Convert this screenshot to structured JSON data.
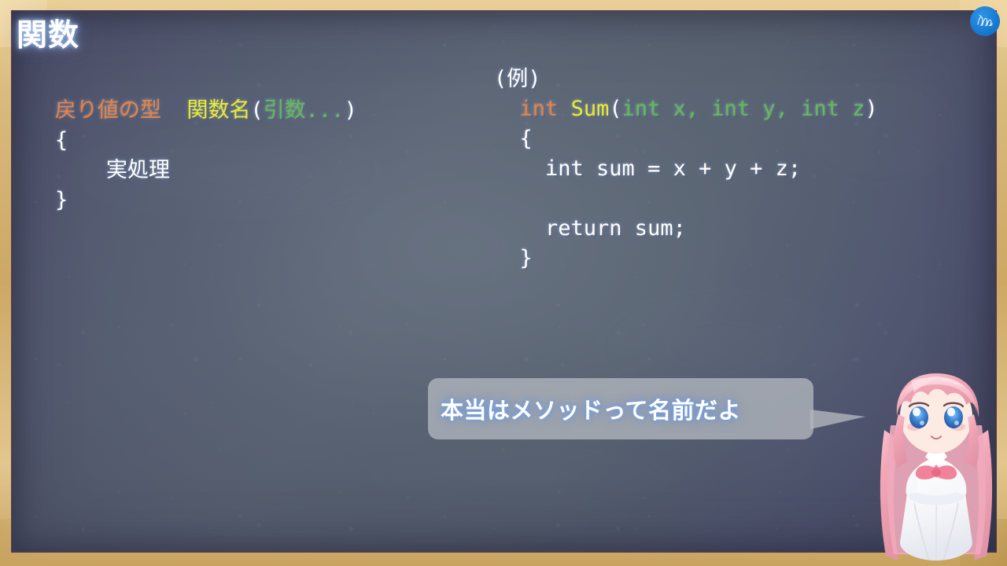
{
  "slide": {
    "title": "関数",
    "board_color": "#5a6472",
    "frame_color": "#d9b97c"
  },
  "syntax_template": {
    "name": "function-syntax-template",
    "lines": [
      {
        "tokens": [
          {
            "text": "戻り値の型",
            "kind": "type",
            "color": "#ef8038"
          },
          {
            "text": "  ",
            "kind": "plain",
            "color": "#ffffff"
          },
          {
            "text": "関数名",
            "kind": "name",
            "color": "#eded21"
          },
          {
            "text": "(",
            "kind": "punct",
            "color": "#ffffff"
          },
          {
            "text": "引数...",
            "kind": "param",
            "color": "#5fbd4f"
          },
          {
            "text": ")",
            "kind": "punct",
            "color": "#ffffff"
          }
        ]
      },
      {
        "tokens": [
          {
            "text": "{",
            "kind": "plain",
            "color": "#ffffff"
          }
        ]
      },
      {
        "tokens": [
          {
            "text": "    実処理",
            "kind": "plain",
            "color": "#ffffff"
          }
        ]
      },
      {
        "tokens": [
          {
            "text": "}",
            "kind": "plain",
            "color": "#ffffff"
          }
        ]
      }
    ]
  },
  "code_example": {
    "name": "code-example-sum",
    "label": "(例)",
    "lines": [
      {
        "tokens": [
          {
            "text": "(例)",
            "kind": "plain",
            "color": "#ffffff"
          }
        ]
      },
      {
        "tokens": [
          {
            "text": "  ",
            "kind": "plain",
            "color": "#ffffff"
          },
          {
            "text": "int",
            "kind": "type",
            "color": "#ef8038"
          },
          {
            "text": " ",
            "kind": "plain",
            "color": "#ffffff"
          },
          {
            "text": "Sum",
            "kind": "name",
            "color": "#eded21"
          },
          {
            "text": "(",
            "kind": "punct",
            "color": "#ffffff"
          },
          {
            "text": "int x, int y, int z",
            "kind": "param",
            "color": "#5fbd4f"
          },
          {
            "text": ")",
            "kind": "punct",
            "color": "#ffffff"
          }
        ]
      },
      {
        "tokens": [
          {
            "text": "  {",
            "kind": "plain",
            "color": "#ffffff"
          }
        ]
      },
      {
        "tokens": [
          {
            "text": "    int sum = x + y + z;",
            "kind": "plain",
            "color": "#ffffff"
          }
        ]
      },
      {
        "tokens": [
          {
            "text": " ",
            "kind": "plain",
            "color": "#ffffff"
          }
        ]
      },
      {
        "tokens": [
          {
            "text": "    return sum;",
            "kind": "plain",
            "color": "#ffffff"
          }
        ]
      },
      {
        "tokens": [
          {
            "text": "  }",
            "kind": "plain",
            "color": "#ffffff"
          }
        ]
      }
    ]
  },
  "speech_bubble": {
    "text": "本当はメソッドって名前だよ",
    "bubble_color": "#b0b5bd",
    "text_color": "#ffffff",
    "glow_color": "#5f91e1"
  },
  "logo": {
    "name": "channel-logo",
    "color": "#1a7cd4"
  },
  "character": {
    "name": "mascot-character",
    "hair_color": "#f0a9b8",
    "eye_color": "#3a7fd0",
    "dress_color": "#ffffff",
    "bow_color": "#f07b94"
  }
}
